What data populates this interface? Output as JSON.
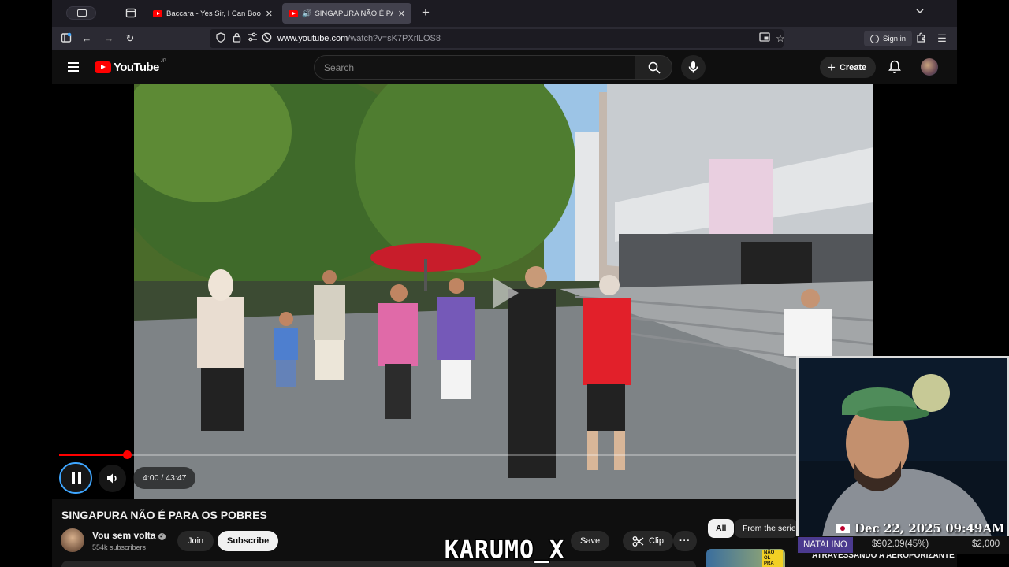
{
  "browser": {
    "tabs": [
      {
        "label": "Baccara - Yes Sir, I Can Boogie",
        "active": false
      },
      {
        "label": "SINGAPURA NÃO É PARA O",
        "active": true
      }
    ],
    "url_host": "www.youtube.com",
    "url_path": "/watch?v=sK7PXrlLOS8",
    "sign_in_label": "Sign in"
  },
  "youtube": {
    "logo_text": "YouTube",
    "logo_region": "JP",
    "search_placeholder": "Search",
    "create_label": "Create"
  },
  "player": {
    "current_time": "4:00",
    "duration": "43:47",
    "time_display": "4:00 / 43:47",
    "progress_fraction": 0.0914,
    "state": "playing"
  },
  "video": {
    "title": "SINGAPURA NÃO É PARA OS POBRES",
    "channel_name": "Vou sem volta",
    "verified": true,
    "subscribers": "554k subscribers",
    "join_label": "Join",
    "subscribe_label": "Subscribe",
    "save_label": "Save",
    "clip_label": "Clip"
  },
  "recommendations": {
    "chips": [
      {
        "label": "All",
        "active": true
      },
      {
        "label": "From the serie",
        "active": false
      }
    ],
    "first_thumb_text": "NÃO OL PRA BAIXO",
    "first_title": "ATRAVESSANDO A AEROPORIZANTE"
  },
  "overlay": {
    "timestamp": "Dec 22, 2025 09:49AM",
    "donor_name": "NATALINO",
    "donation_value": "$902.09(45%)",
    "donation_goal": "$2,000",
    "watermark": "KARUMO_X"
  },
  "colors": {
    "youtube_red": "#ff0000",
    "focus_ring": "#3ea6ff",
    "page_bg": "#0f0f0f"
  }
}
